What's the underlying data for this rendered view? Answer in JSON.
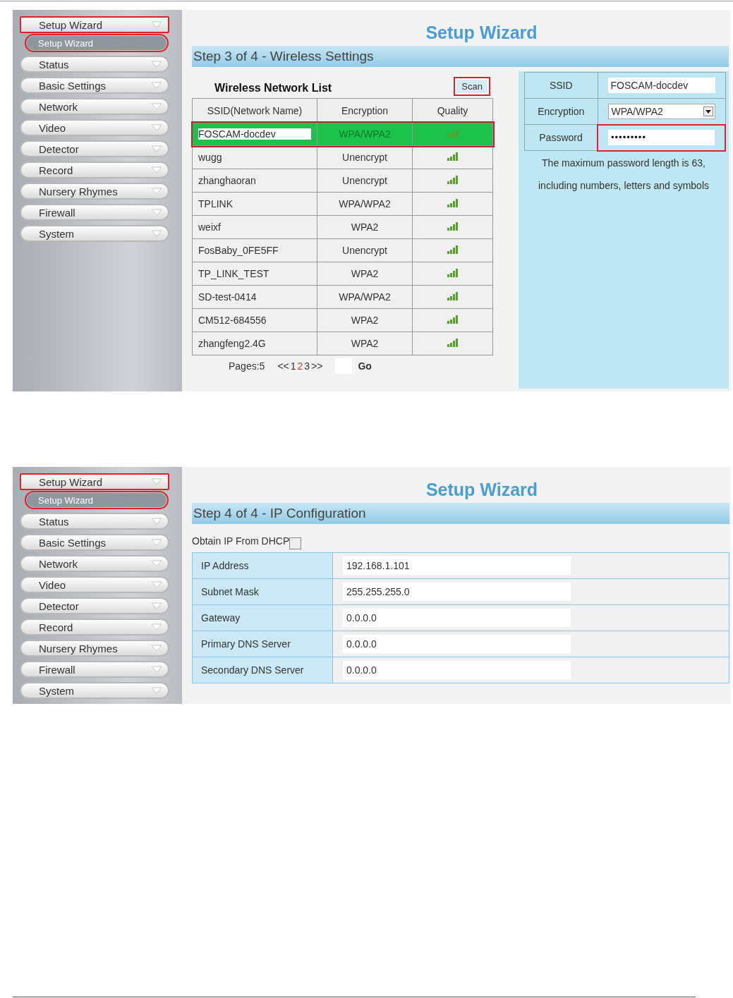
{
  "screenshots": [
    {
      "kind": "wireless",
      "sidebar": {
        "menu": [
          {
            "label": "Setup Wizard",
            "highlighted": true,
            "children": [
              {
                "label": "Setup Wizard",
                "selected": true,
                "highlighted": true
              }
            ]
          },
          {
            "label": "Status",
            "highlighted": false
          },
          {
            "label": "Basic Settings",
            "highlighted": false
          },
          {
            "label": "Network",
            "highlighted": false
          },
          {
            "label": "Video",
            "highlighted": false
          },
          {
            "label": "Detector",
            "highlighted": false
          },
          {
            "label": "Record",
            "highlighted": false
          },
          {
            "label": "Nursery Rhymes",
            "highlighted": false
          },
          {
            "label": "Firewall",
            "highlighted": false
          },
          {
            "label": "System",
            "highlighted": false
          }
        ]
      },
      "title": "Setup Wizard",
      "step": "Step 3 of 4 - Wireless Settings",
      "network_list": {
        "title": "Wireless Network List",
        "scan_button": {
          "label": "Scan",
          "highlighted": true
        },
        "columns": [
          "SSID(Network Name)",
          "Encryption",
          "Quality"
        ],
        "rows": [
          {
            "ssid": "FOSCAM-docdev",
            "encryption": "WPA/WPA2",
            "selected": true
          },
          {
            "ssid": "wugg",
            "encryption": "Unencrypt",
            "selected": false
          },
          {
            "ssid": "zhanghaoran",
            "encryption": "Unencrypt",
            "selected": false
          },
          {
            "ssid": "TPLINK",
            "encryption": "WPA/WPA2",
            "selected": false
          },
          {
            "ssid": "weixf",
            "encryption": "WPA2",
            "selected": false
          },
          {
            "ssid": "FosBaby_0FE5FF",
            "encryption": "Unencrypt",
            "selected": false
          },
          {
            "ssid": "TP_LINK_TEST",
            "encryption": "WPA2",
            "selected": false
          },
          {
            "ssid": "SD-test-0414",
            "encryption": "WPA/WPA2",
            "selected": false
          },
          {
            "ssid": "CM512-684556",
            "encryption": "WPA2",
            "selected": false
          },
          {
            "ssid": "zhangfeng2.4G",
            "encryption": "WPA2",
            "selected": false
          }
        ],
        "pager": {
          "pages_label": "Pages:5",
          "prev": "<<",
          "pages": [
            {
              "label": "1",
              "selected": false
            },
            {
              "label": "2",
              "selected": true
            },
            {
              "label": "3",
              "selected": false
            }
          ],
          "next": ">>",
          "go_button": "Go"
        }
      },
      "form": {
        "fields": [
          {
            "kind": "text",
            "label": "SSID",
            "value": "FOSCAM-docdev",
            "highlighted": false
          },
          {
            "kind": "select",
            "label": "Encryption",
            "value": "WPA/WPA2",
            "highlighted": false
          },
          {
            "kind": "password",
            "label": "Password",
            "value": "•••••••••",
            "highlighted": true
          }
        ],
        "note": "The maximum password length is 63, including numbers, letters and symbols"
      }
    },
    {
      "kind": "ip",
      "sidebar": {
        "menu": [
          {
            "label": "Setup Wizard",
            "highlighted": true,
            "children": [
              {
                "label": "Setup Wizard",
                "selected": true,
                "highlighted": true
              }
            ]
          },
          {
            "label": "Status",
            "highlighted": false
          },
          {
            "label": "Basic Settings",
            "highlighted": false
          },
          {
            "label": "Network",
            "highlighted": false
          },
          {
            "label": "Video",
            "highlighted": false
          },
          {
            "label": "Detector",
            "highlighted": false
          },
          {
            "label": "Record",
            "highlighted": false
          },
          {
            "label": "Nursery Rhymes",
            "highlighted": false
          },
          {
            "label": "Firewall",
            "highlighted": false
          },
          {
            "label": "System",
            "highlighted": false
          }
        ]
      },
      "title": "Setup Wizard",
      "step": "Step 4 of 4 - IP Configuration",
      "dhcp": {
        "label": "Obtain IP From DHCP",
        "checked": false
      },
      "fields": [
        {
          "label": "IP Address",
          "value": "192.168.1.101"
        },
        {
          "label": "Subnet Mask",
          "value": "255.255.255.0"
        },
        {
          "label": "Gateway",
          "value": "0.0.0.0"
        },
        {
          "label": "Primary DNS Server",
          "value": "0.0.0.0"
        },
        {
          "label": "Secondary DNS Server",
          "value": "0.0.0.0"
        }
      ]
    }
  ]
}
